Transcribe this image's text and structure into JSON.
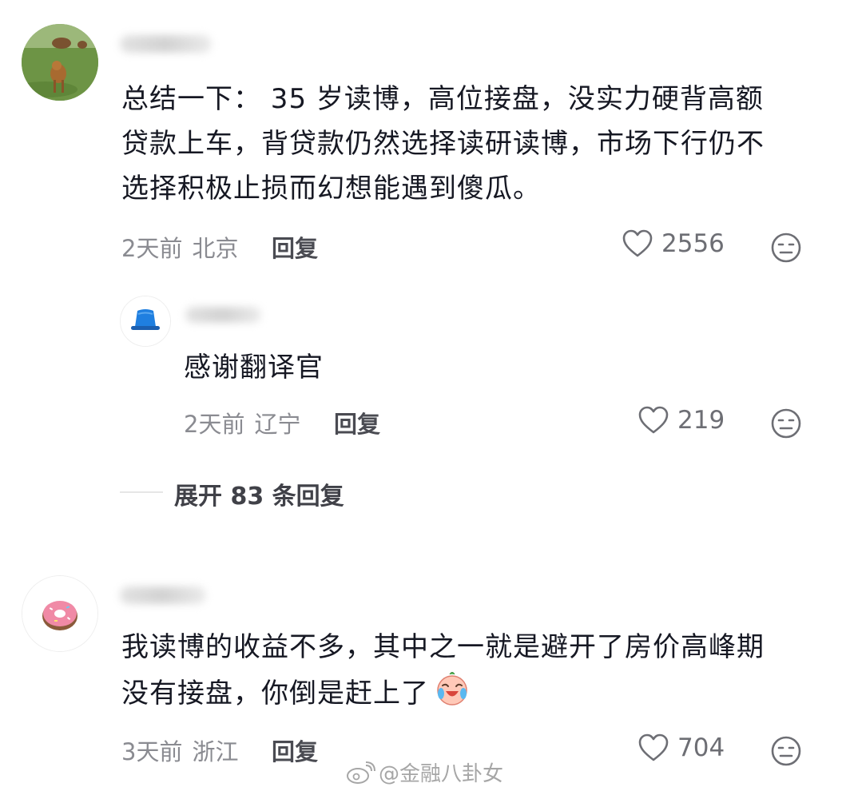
{
  "comments": [
    {
      "text_lines": [
        "总结一下： 35 岁读博，高位接盘，没实力硬背高额",
        "贷款上车，背贷款仍然选择读研读博，市场下行仍不",
        "选择积极止损而幻想能遇到傻瓜。"
      ],
      "time": "2天前",
      "location": "北京",
      "reply_label": "回复",
      "likes": "2556",
      "avatar_icon": "cow-avatar"
    },
    {
      "text_lines": [
        "感谢翻译官"
      ],
      "time": "2天前",
      "location": "辽宁",
      "reply_label": "回复",
      "likes": "219",
      "avatar_icon": "blue-hat-avatar"
    },
    {
      "text_lines": [
        "我读博的收益不多，其中之一就是避开了房价高峰期",
        "没有接盘，你倒是赶上了"
      ],
      "time": "3天前",
      "location": "浙江",
      "reply_label": "回复",
      "likes": "704",
      "avatar_icon": "donut-avatar"
    }
  ],
  "expand_replies": "展开 83 条回复",
  "watermark": "@金融八卦女",
  "icons": {
    "like": "heart-outline-icon",
    "dislike": "neutral-face-icon",
    "emoji": "crying-laugh-emoji"
  }
}
